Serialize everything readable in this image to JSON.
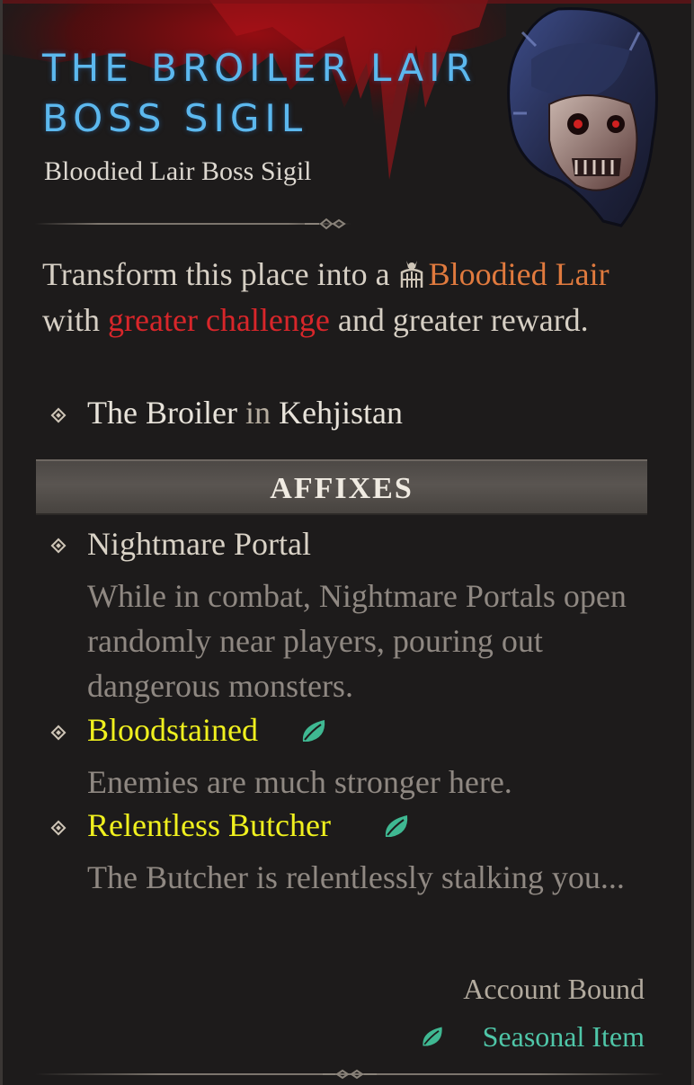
{
  "item": {
    "title_line1": "THE BROILER LAIR",
    "title_line2": "BOSS SIGIL",
    "subtitle": "Bloodied Lair Boss Sigil",
    "icon": "skull-helm-sigil-icon"
  },
  "description": {
    "part1": "Transform this place into a ",
    "lair_icon": "lair-gate-icon",
    "highlight1": "Bloodied Lair",
    "part2": " with ",
    "highlight2": "greater challenge",
    "part3": " and greater reward."
  },
  "location": {
    "place": "The Broiler",
    "connector": " in ",
    "region": "Kehjistan"
  },
  "affixes": {
    "header": "AFFIXES",
    "items": [
      {
        "name": "Nightmare Portal",
        "description": "While in combat, Nightmare Portals open randomly near players, pouring out dangerous monsters.",
        "seasonal": false
      },
      {
        "name": "Bloodstained",
        "description": "Enemies are much stronger here.",
        "seasonal": true
      },
      {
        "name": "Relentless Butcher",
        "description": "The Butcher is relentlessly stalking you...",
        "seasonal": true
      }
    ]
  },
  "footer": {
    "account_bound": "Account Bound",
    "seasonal_item": "Seasonal Item"
  },
  "colors": {
    "title": "#5cb8ee",
    "bloodied": "#e07a3e",
    "challenge": "#d8262a",
    "affix_gold": "#f0f01e",
    "seasonal": "#4fc6a8"
  }
}
